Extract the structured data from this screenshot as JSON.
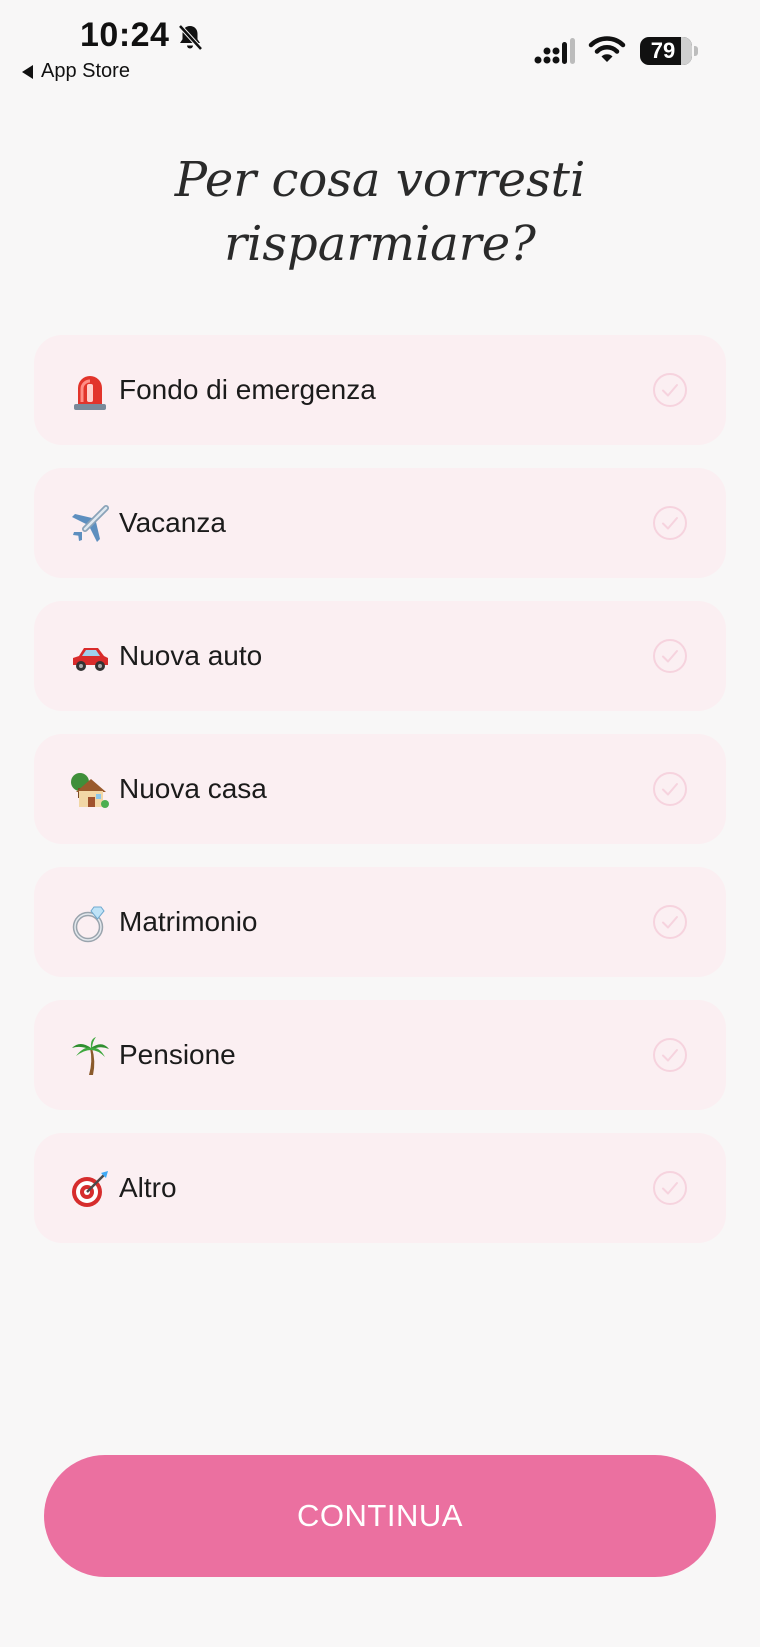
{
  "status_bar": {
    "time": "10:24",
    "back_label": "App Store",
    "battery_level": "79"
  },
  "title_line1": "Per cosa vorresti",
  "title_line2": "risparmiare?",
  "options": [
    {
      "label": "Fondo di emergenza",
      "icon": "siren-icon",
      "selected": false
    },
    {
      "label": "Vacanza",
      "icon": "airplane-icon",
      "selected": false
    },
    {
      "label": "Nuova auto",
      "icon": "car-icon",
      "selected": false
    },
    {
      "label": "Nuova casa",
      "icon": "house-icon",
      "selected": false
    },
    {
      "label": "Matrimonio",
      "icon": "ring-icon",
      "selected": false
    },
    {
      "label": "Pensione",
      "icon": "palm-tree-icon",
      "selected": false
    },
    {
      "label": "Altro",
      "icon": "target-icon",
      "selected": false
    }
  ],
  "continue_label": "CONTINUA",
  "colors": {
    "accent": "#eb70a0",
    "option_bg": "#fbeff2",
    "check": "#f6d3de",
    "background": "#f8f7f7"
  }
}
